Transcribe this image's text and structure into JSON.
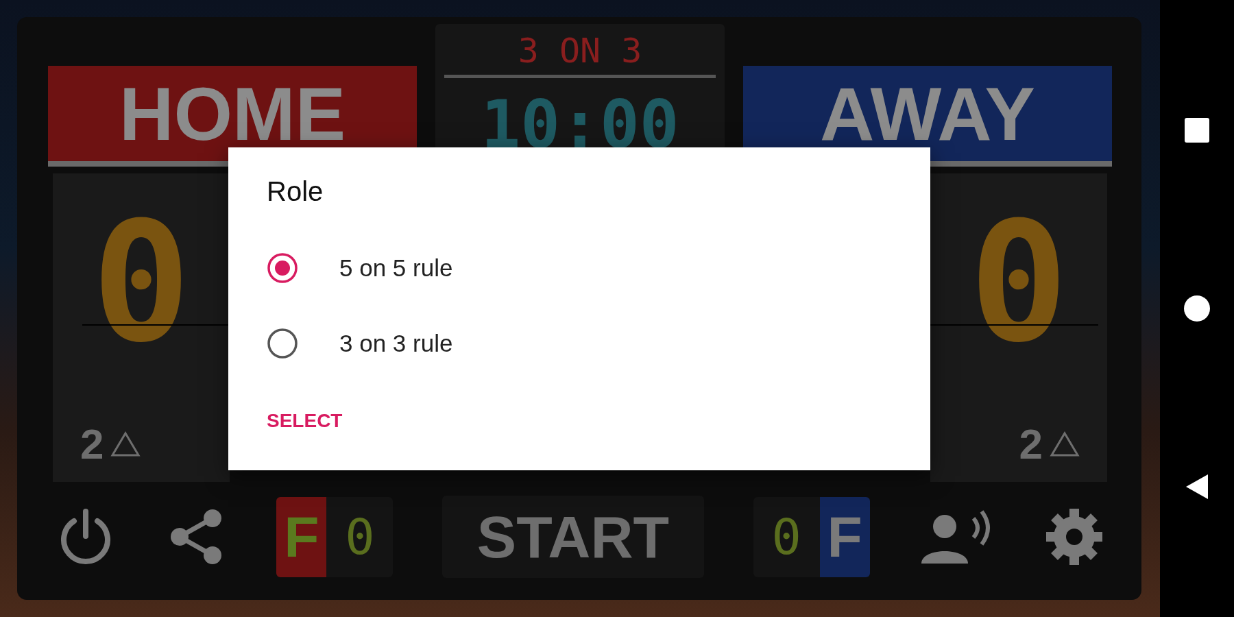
{
  "scoreboard": {
    "home": {
      "name": "HOME",
      "score": "0",
      "count": "2"
    },
    "mode": "3 ON 3",
    "clock": "10:00",
    "away": {
      "name": "AWAY",
      "score": "0",
      "count": "2"
    },
    "home_fouls": {
      "label": "F",
      "value": "0"
    },
    "start_button": "START",
    "away_fouls": {
      "label": "F",
      "value": "0"
    }
  },
  "dialog": {
    "title": "Role",
    "options": [
      {
        "label": "5 on 5 rule",
        "selected": true
      },
      {
        "label": "3 on 3 rule",
        "selected": false
      }
    ],
    "action": "SELECT"
  }
}
